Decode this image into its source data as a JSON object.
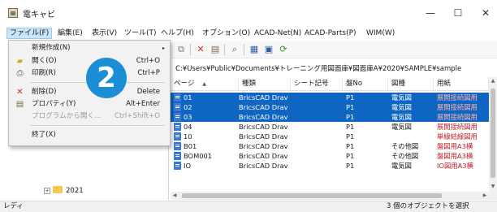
{
  "window": {
    "title": "電キャビ",
    "minimize": "—",
    "maximize": "☐",
    "close": "✕"
  },
  "menubar": [
    {
      "label": "ファイル(F)",
      "active": true
    },
    {
      "label": "編集(E)"
    },
    {
      "label": "表示(V)"
    },
    {
      "label": "ツール(T)"
    },
    {
      "label": "ヘルプ(H)"
    },
    {
      "label": "オプション(O)"
    },
    {
      "label": "ACAD-Net(N)"
    },
    {
      "label": "ACAD-Parts(P)"
    },
    {
      "label": "WIM(W)"
    }
  ],
  "file_menu": {
    "items": [
      {
        "label": "新規作成(N)",
        "shortcut": "",
        "submenu": "▸",
        "icon": ""
      },
      {
        "label": "開く(O)",
        "shortcut": "Ctrl+O",
        "icon": "open-folder-icon"
      },
      {
        "label": "印刷(R)",
        "shortcut": "Ctrl+P",
        "icon": "printer-icon"
      },
      {
        "label": "削除(D)",
        "shortcut": "Delete",
        "icon": "delete-x-icon"
      },
      {
        "label": "プロパティ(Y)",
        "shortcut": "Alt+Enter",
        "icon": "properties-icon"
      },
      {
        "label": "プログラムから開く...",
        "shortcut": "Ctrl+Shift+O",
        "disabled": true
      },
      {
        "label": "終了(X)",
        "shortcut": ""
      }
    ]
  },
  "step_badge": "2",
  "path": "C:¥Users¥Public¥Documents¥トレーニング用図面庫¥図面庫A¥2020¥SAMPLE¥sample",
  "tree": {
    "folder_label": "2021"
  },
  "table": {
    "headers": [
      "ページ",
      "種類",
      "シート記号",
      "盤No",
      "図種",
      "用紙"
    ],
    "rows": [
      {
        "page": "01",
        "type": "BricsCAD Drav",
        "sheet": "",
        "panel": "P1",
        "kind": "電気図",
        "paper": "展開接続図用",
        "selected": true
      },
      {
        "page": "02",
        "type": "BricsCAD Drav",
        "sheet": "",
        "panel": "P1",
        "kind": "電気図",
        "paper": "展開接続図用",
        "selected": true
      },
      {
        "page": "03",
        "type": "BricsCAD Drav",
        "sheet": "",
        "panel": "P1",
        "kind": "電気図",
        "paper": "展開接続図用",
        "selected": true
      },
      {
        "page": "04",
        "type": "BricsCAD Drav",
        "sheet": "",
        "panel": "P1",
        "kind": "電気図",
        "paper": "展開接続図用",
        "selected": false
      },
      {
        "page": "10",
        "type": "BricsCAD Drav",
        "sheet": "",
        "panel": "P1",
        "kind": "",
        "paper": "単線結線図用",
        "selected": false
      },
      {
        "page": "B01",
        "type": "BricsCAD Drav",
        "sheet": "",
        "panel": "P1",
        "kind": "その他図",
        "paper": "盤図用A3横",
        "selected": false
      },
      {
        "page": "BOM001",
        "type": "BricsCAD Drav",
        "sheet": "",
        "panel": "P1",
        "kind": "その他図",
        "paper": "盤図用A3横",
        "selected": false
      },
      {
        "page": "IO",
        "type": "BricsCAD Drav",
        "sheet": "",
        "panel": "P1",
        "kind": "電気図",
        "paper": "IO図用A3横",
        "selected": false
      }
    ]
  },
  "status": {
    "left": "レディ",
    "right": "3 個のオブジェクトを選択"
  },
  "colors": {
    "selection": "#0f66c2",
    "accent_badge": "#1a8fd6",
    "red_text": "#c0222b"
  }
}
